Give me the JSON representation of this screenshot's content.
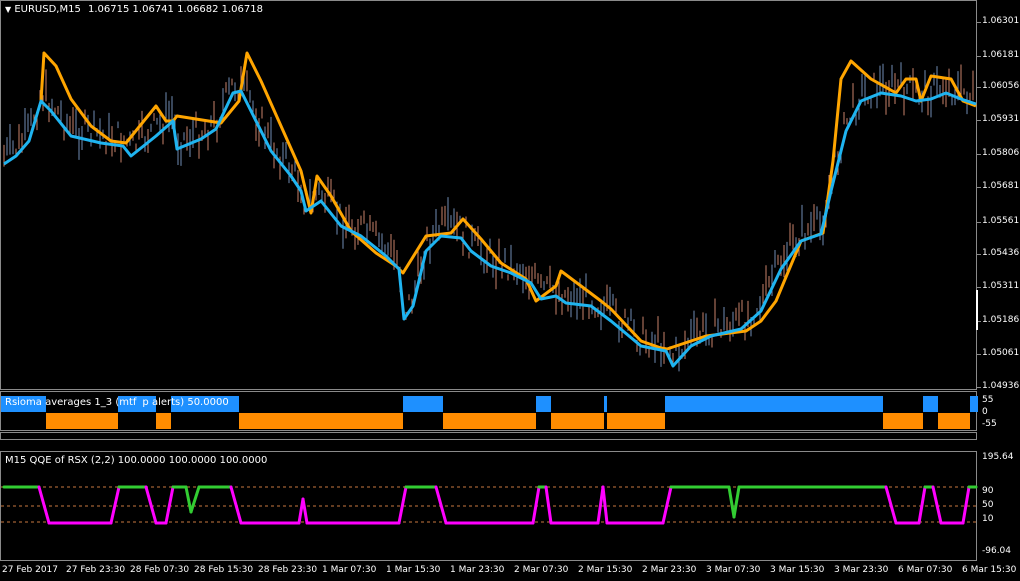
{
  "main": {
    "symbol_title": "EURUSD,M15",
    "ohlc": "1.06715 1.06741 1.06682 1.06718",
    "price_axis": [
      "1.06301",
      "1.06181",
      "1.06056",
      "1.05931",
      "1.05806",
      "1.05681",
      "1.05561",
      "1.05436",
      "1.05311",
      "1.05186",
      "1.05061",
      "1.04936"
    ]
  },
  "rsioma": {
    "title": "Rsioma averages 1_3 (mtf",
    "title2": "p alerts) 50.0000",
    "axis": [
      "55",
      "0",
      "-55"
    ],
    "colors": {
      "up": "#1e90ff",
      "down": "#ff8c00"
    }
  },
  "qqe": {
    "title": "M15 QQE of RSX (2,2) 100.0000 100.0000 100.0000",
    "axis": [
      "195.64",
      "90",
      "50",
      "10",
      "-96.04"
    ],
    "colors": {
      "up": "#32cd32",
      "down": "#ff00ff"
    }
  },
  "time_axis": [
    "27 Feb 2017",
    "27 Feb 23:30",
    "28 Feb 07:30",
    "28 Feb 15:30",
    "28 Feb 23:30",
    "1 Mar 07:30",
    "1 Mar 15:30",
    "1 Mar 23:30",
    "2 Mar 07:30",
    "2 Mar 15:30",
    "2 Mar 23:30",
    "3 Mar 07:30",
    "3 Mar 15:30",
    "3 Mar 23:30",
    "6 Mar 07:30",
    "6 Mar 15:30"
  ],
  "colors": {
    "bull": "#6f8db3",
    "bear": "#c8826a",
    "fast_ma": "#1fb4f0",
    "slow_ma": "#ffa500",
    "grid": "#8a8a8a"
  }
}
